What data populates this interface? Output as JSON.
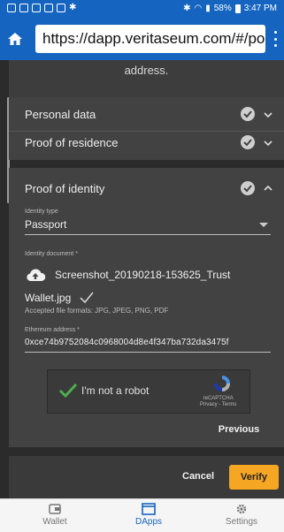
{
  "status_bar": {
    "battery": "58%",
    "time": "3:47 PM"
  },
  "browser": {
    "url": "https://dapp.veritaseum.com/#/por"
  },
  "form": {
    "address_text": "address.",
    "sections": {
      "personal": "Personal data",
      "residence": "Proof of residence",
      "identity": "Proof of identity"
    },
    "identity_type": {
      "label": "Identity type",
      "value": "Passport"
    },
    "identity_document": {
      "label": "Identity document *",
      "file_line1": "Screenshot_20190218-153625_Trust",
      "file_line2": "Wallet.jpg",
      "formats": "Accepted file formats: JPG, JPEG, PNG, PDF"
    },
    "ethereum": {
      "label": "Ethereum address *",
      "value": "0xce74b9752084c0968004d8e4f347ba732da3475f"
    },
    "captcha": {
      "text": "I'm not a robot",
      "brand": "reCAPTCHA",
      "links": "Privacy - Terms"
    },
    "buttons": {
      "previous": "Previous",
      "cancel": "Cancel",
      "verify": "Verify"
    }
  },
  "nav": {
    "wallet": "Wallet",
    "dapps": "DApps",
    "settings": "Settings"
  },
  "colors": {
    "brand_blue": "#1565c0",
    "accent_orange": "#f5a623",
    "check_green": "#4caf50"
  }
}
